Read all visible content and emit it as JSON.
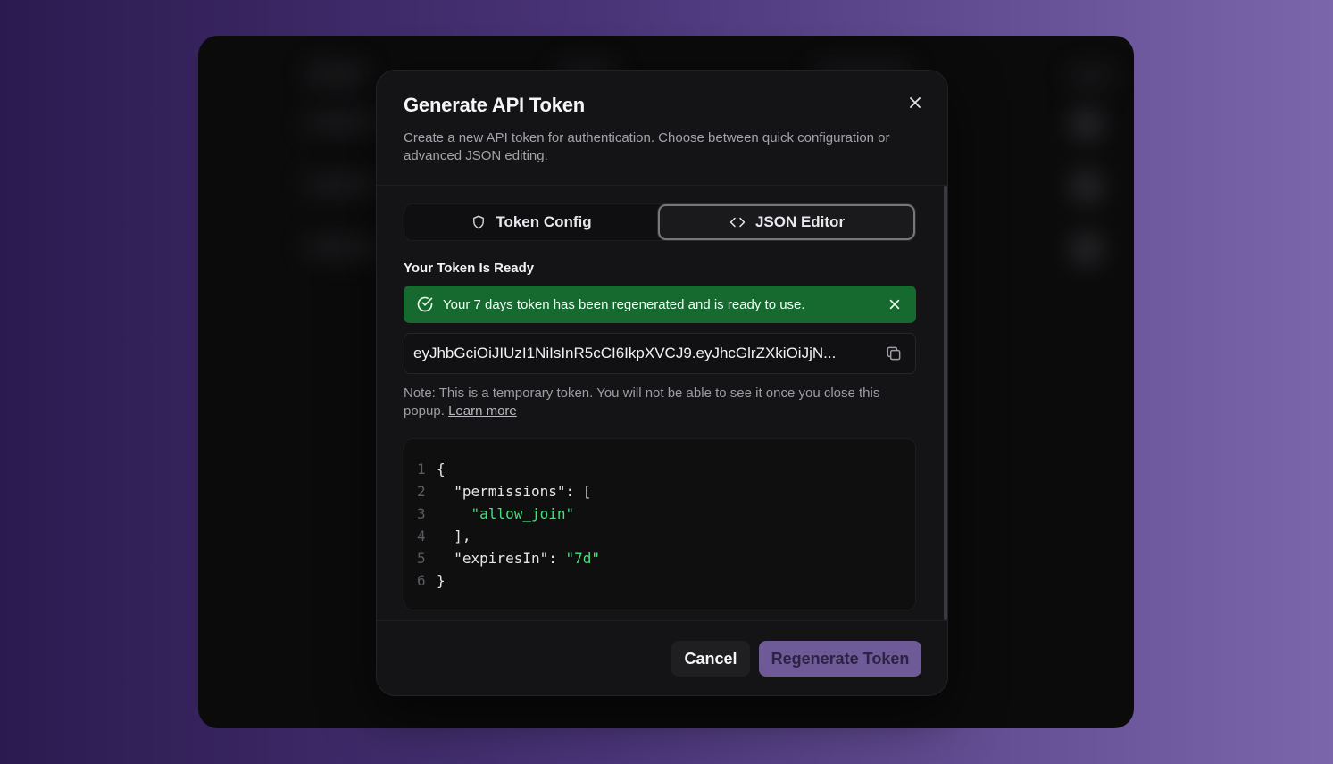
{
  "modal": {
    "title": "Generate API Token",
    "description": "Create a new API token for authentication. Choose between quick configuration or advanced JSON editing.",
    "close_icon": "close-icon"
  },
  "tabs": [
    {
      "label": "Token Config",
      "icon": "shield-icon",
      "active": false
    },
    {
      "label": "JSON Editor",
      "icon": "code-brackets-icon",
      "active": true
    }
  ],
  "token_section": {
    "heading": "Your Token Is Ready",
    "alert_text": "Your 7 days token has been regenerated and is ready to use.",
    "alert_icon": "check-circle-icon",
    "token_value": "eyJhbGciOiJIUzI1NiIsInR5cCI6IkpXVCJ9.eyJhcGlrZXkiOiJjN...",
    "copy_icon": "copy-icon",
    "note": "Note: This is a temporary token. You will not be able to see it once you close this popup.",
    "learn_more": "Learn more"
  },
  "json_editor": {
    "lines": [
      {
        "n": "1",
        "parts": [
          {
            "t": "{",
            "c": "tx"
          }
        ]
      },
      {
        "n": "2",
        "parts": [
          {
            "t": "  \"permissions\": [",
            "c": "tx"
          }
        ]
      },
      {
        "n": "3",
        "parts": [
          {
            "t": "    ",
            "c": "tx"
          },
          {
            "t": "\"allow_join\"",
            "c": "str"
          }
        ]
      },
      {
        "n": "4",
        "parts": [
          {
            "t": "  ],",
            "c": "tx"
          }
        ]
      },
      {
        "n": "5",
        "parts": [
          {
            "t": "  \"expiresIn\": ",
            "c": "tx"
          },
          {
            "t": "\"7d\"",
            "c": "str"
          }
        ]
      },
      {
        "n": "6",
        "parts": [
          {
            "t": "}",
            "c": "tx"
          }
        ]
      }
    ]
  },
  "footer": {
    "cancel_label": "Cancel",
    "regenerate_label": "Regenerate Token"
  },
  "colors": {
    "alert_bg": "#16692f",
    "primary_button": "#6d5a97",
    "code_string": "#4ade80"
  }
}
